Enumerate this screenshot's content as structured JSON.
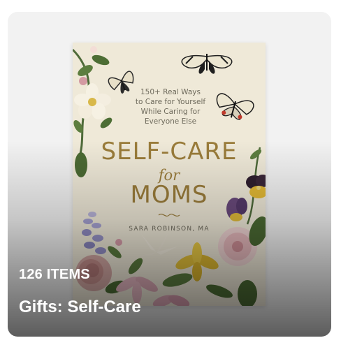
{
  "card": {
    "item_count": "126 ITEMS",
    "title": "Gifts: Self-Care"
  },
  "book_cover": {
    "subtitle": "150+ Real Ways\nto Care for Yourself\nWhile Caring for\nEveryone Else",
    "title_line1": "SELF-CARE",
    "title_line2": "for",
    "title_line3": "MOMS",
    "author": "SARA ROBINSON, MA"
  },
  "colors": {
    "cover_background": "#efe9d8",
    "title_gold": "#9a7c3a",
    "overlay_text": "#ffffff"
  }
}
